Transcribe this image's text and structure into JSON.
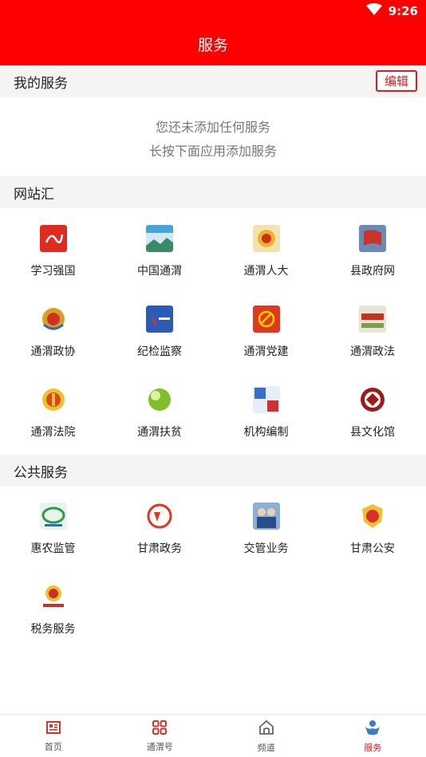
{
  "status": {
    "time": "9:26"
  },
  "header": {
    "title": "服务"
  },
  "my_services": {
    "heading": "我的服务",
    "edit_label": "编辑",
    "empty_line1": "您还未添加任何服务",
    "empty_line2": "长按下面应用添加服务"
  },
  "websites": {
    "heading": "网站汇",
    "items": [
      {
        "label": "学习强国",
        "icon": "xuexi-qiangguo-icon",
        "color": "#e02b20"
      },
      {
        "label": "中国通渭",
        "icon": "zhongguo-tongwei-icon",
        "color": "#4aa3d8"
      },
      {
        "label": "通渭人大",
        "icon": "tongwei-renda-icon",
        "color": "#e8b531"
      },
      {
        "label": "县政府网",
        "icon": "county-government-icon",
        "color": "#c8332b"
      },
      {
        "label": "通渭政协",
        "icon": "tongwei-zhengxie-icon",
        "color": "#d8a020"
      },
      {
        "label": "纪检监察",
        "icon": "discipline-inspection-icon",
        "color": "#2b5bb8"
      },
      {
        "label": "通渭党建",
        "icon": "party-building-icon",
        "color": "#e03a1e"
      },
      {
        "label": "通渭政法",
        "icon": "politics-law-icon",
        "color": "#7aa04a"
      },
      {
        "label": "通渭法院",
        "icon": "court-emblem-icon",
        "color": "#d84a1e"
      },
      {
        "label": "通渭扶贫",
        "icon": "poverty-relief-icon",
        "color": "#7ec02a"
      },
      {
        "label": "机构编制",
        "icon": "institution-staffing-icon",
        "color": "#3a6fc8"
      },
      {
        "label": "县文化馆",
        "icon": "cultural-center-icon",
        "color": "#9b1c1c"
      }
    ]
  },
  "public_services": {
    "heading": "公共服务",
    "items": [
      {
        "label": "惠农监管",
        "icon": "farm-benefit-icon",
        "color": "#2e9a4a"
      },
      {
        "label": "甘肃政务",
        "icon": "gansu-government-icon",
        "color": "#e0361e"
      },
      {
        "label": "交管业务",
        "icon": "traffic-police-icon",
        "color": "#2a4d8a"
      },
      {
        "label": "甘肃公安",
        "icon": "police-badge-icon",
        "color": "#d8302a"
      },
      {
        "label": "税务服务",
        "icon": "tax-emblem-icon",
        "color": "#c8302a"
      }
    ]
  },
  "bottom_nav": {
    "items": [
      {
        "label": "首页",
        "icon": "home-news-icon"
      },
      {
        "label": "通渭号",
        "icon": "grid-apps-icon"
      },
      {
        "label": "频道",
        "icon": "house-outline-icon"
      },
      {
        "label": "服务",
        "icon": "service-person-icon"
      }
    ],
    "active_index": 3,
    "active_color": "#e31b1b"
  }
}
